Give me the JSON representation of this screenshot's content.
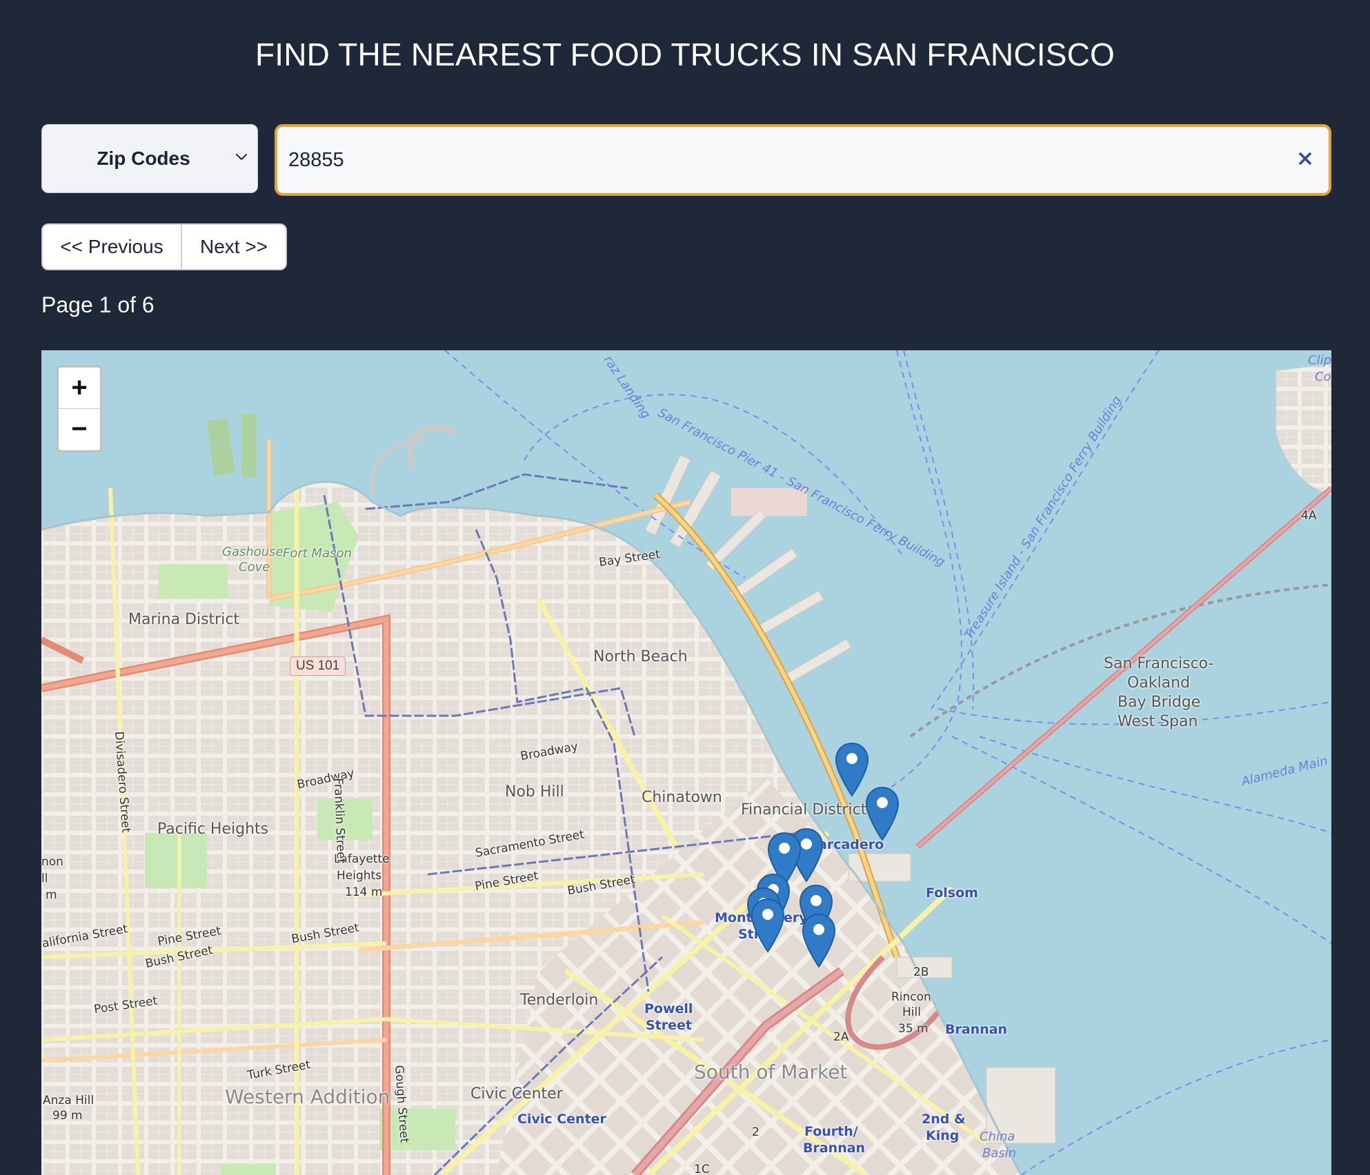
{
  "header": {
    "title": "FIND THE NEAREST FOOD TRUCKS IN SAN FRANCISCO"
  },
  "filter": {
    "selected": "Zip Codes",
    "icon": "chevron-down-icon"
  },
  "search": {
    "value": "28855",
    "clear_icon": "close-icon",
    "accent_color": "#e3a338"
  },
  "pagination": {
    "previous_label": "<< Previous",
    "next_label": "Next >>",
    "page_text": "Page 1 of 6"
  },
  "map": {
    "zoom_in_label": "+",
    "zoom_out_label": "−",
    "highway_shield": "US 101",
    "labels": {
      "marina": "Marina District",
      "north_beach": "North Beach",
      "pacific_heights": "Pacific Heights",
      "nob_hill": "Nob Hill",
      "chinatown": "Chinatown",
      "financial": "Financial District",
      "tenderloin": "Tenderloin",
      "civic_center": "Civic Center",
      "western_addition": "Western Addition",
      "soma": "South of Market",
      "lafayette": "Lafayette",
      "lafayette2": "Heights",
      "lafayette3": "114 m",
      "rincon": "Rincon",
      "rincon2": "Hill",
      "rincon3": "35 m",
      "anza": "Anza Hill",
      "anza2": "99 m",
      "gashouse": "Gashouse",
      "gashouse2": "Cove",
      "fort_mason": "Fort Mason",
      "bay_bridge1": "San Francisco-",
      "bay_bridge2": "Oakland",
      "bay_bridge3": "Bay Bridge",
      "bay_bridge4": "West Span",
      "china_basin": "China",
      "china_basin2": "Basin",
      "bay_street": "Bay Street",
      "broadway1": "Broadway",
      "broadway2": "Broadway",
      "sacramento": "Sacramento Street",
      "pine1": "Pine Street",
      "pine2": "Pine Street",
      "bush1": "Bush Street",
      "bush2": "Bush Street",
      "bush3": "Bush Street",
      "california": "alifornia Street",
      "post": "Post Street",
      "turk": "Turk Street",
      "franklin": "Franklin Street",
      "divisadero": "Divisadero Street",
      "gough": "Gough Street",
      "embarcadero": "arcadero",
      "montgomery1": "Mont",
      "montgomery2": "ery",
      "montgomery3": "Str",
      "folsom": "Folsom",
      "brannan": "Brannan",
      "powell1": "Powell",
      "powell2": "Street",
      "civic_center_station": "Civic Center",
      "fourth1": "Fourth/",
      "fourth2": "Brannan",
      "second1": "2nd &",
      "second2": "King",
      "ferry1": "San Francisco Pier 41 - San Francisco Ferry Building",
      "ferry2": "Treasure Island - San Francisco Ferry Building",
      "alcatraz": "raz Landing",
      "alameda": "Alameda Main",
      "clip": "Clip",
      "clip2": "Co",
      "edge1": "non",
      "edge2": "ll",
      "edge3": "m",
      "rt_2b": "2B",
      "rt_2a": "2A",
      "rt_4a": "4A",
      "rt_1c": "1C",
      "rt_2": "2"
    },
    "marker_count": 9,
    "marker_color": "#2f7bc8",
    "marker_icon": "map-pin-icon"
  }
}
